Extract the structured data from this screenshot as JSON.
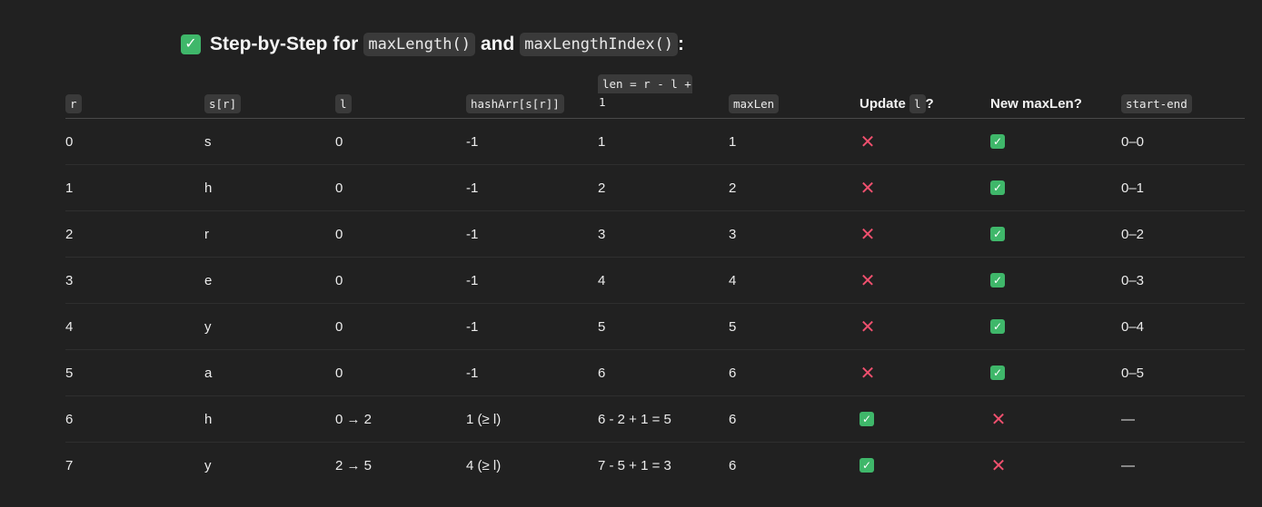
{
  "heading": {
    "icon": "check-mark-button-icon",
    "prefix": "Step-by-Step for",
    "code1": "maxLength()",
    "conjunction": "and",
    "code2": "maxLengthIndex()",
    "suffix": ":"
  },
  "table": {
    "headers": {
      "r": "r",
      "s_r": "s[r]",
      "l": "l",
      "hashArr": "hashArr[s[r]]",
      "len_line1": "len = r - l +",
      "len_line2": "1",
      "maxLen": "maxLen",
      "update_prefix": "Update",
      "update_code": "l",
      "update_suffix": "?",
      "newMaxLen": "New maxLen?",
      "startEnd": "start-end"
    },
    "rows": [
      {
        "r": "0",
        "s": "s",
        "l": "0",
        "hash": "-1",
        "len": "1",
        "maxLen": "1",
        "update": "no",
        "newMax": "yes",
        "range": "0–0"
      },
      {
        "r": "1",
        "s": "h",
        "l": "0",
        "hash": "-1",
        "len": "2",
        "maxLen": "2",
        "update": "no",
        "newMax": "yes",
        "range": "0–1"
      },
      {
        "r": "2",
        "s": "r",
        "l": "0",
        "hash": "-1",
        "len": "3",
        "maxLen": "3",
        "update": "no",
        "newMax": "yes",
        "range": "0–2"
      },
      {
        "r": "3",
        "s": "e",
        "l": "0",
        "hash": "-1",
        "len": "4",
        "maxLen": "4",
        "update": "no",
        "newMax": "yes",
        "range": "0–3"
      },
      {
        "r": "4",
        "s": "y",
        "l": "0",
        "hash": "-1",
        "len": "5",
        "maxLen": "5",
        "update": "no",
        "newMax": "yes",
        "range": "0–4"
      },
      {
        "r": "5",
        "s": "a",
        "l": "0",
        "hash": "-1",
        "len": "6",
        "maxLen": "6",
        "update": "no",
        "newMax": "yes",
        "range": "0–5"
      },
      {
        "r": "6",
        "s": "h",
        "l": "0 → 2",
        "hash": "1 (≥ l)",
        "len": "6 - 2 + 1 = 5",
        "maxLen": "6",
        "update": "yes",
        "newMax": "no",
        "range": "—"
      },
      {
        "r": "7",
        "s": "y",
        "l": "2 → 5",
        "hash": "4 (≥ l)",
        "len": "7 - 5 + 1 = 3",
        "maxLen": "6",
        "update": "yes",
        "newMax": "no",
        "range": "—"
      }
    ],
    "marks": {
      "yes_glyph": "✓",
      "no_glyph": "✕",
      "yes_color": "#3fb76a",
      "no_color": "#f0506e"
    }
  }
}
